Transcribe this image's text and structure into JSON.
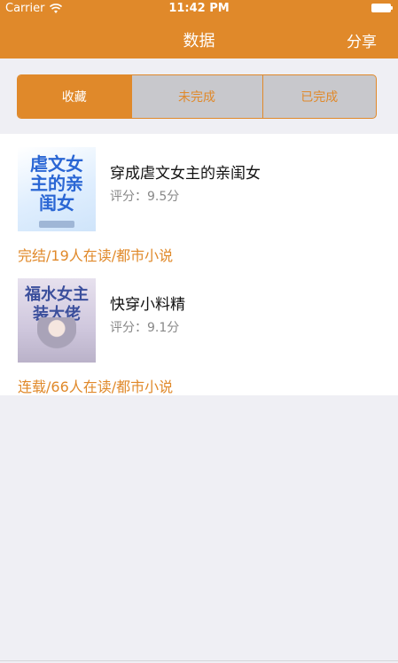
{
  "status_bar": {
    "carrier": "Carrier",
    "wifi_icon": "wifi-icon",
    "time": "11:42 PM",
    "battery_icon": "battery-icon"
  },
  "nav": {
    "title": "数据",
    "share_label": "分享"
  },
  "segments": [
    {
      "label": "收藏",
      "selected": true
    },
    {
      "label": "未完成",
      "selected": false
    },
    {
      "label": "已完成",
      "selected": false
    }
  ],
  "books": [
    {
      "cover_text": "虐文女主的亲闺女",
      "title": "穿成虐文女主的亲闺女",
      "rating": "评分：9.5分",
      "meta": "完结/19人在读/都市小说"
    },
    {
      "cover_text": "福水女主装大佬",
      "title": "快穿小料精",
      "rating": "评分：9.1分",
      "meta": "连载/66人在读/都市小说"
    }
  ],
  "colors": {
    "accent": "#e0892a",
    "background": "#efeff4",
    "segment_unselected": "#c8c8cc"
  }
}
